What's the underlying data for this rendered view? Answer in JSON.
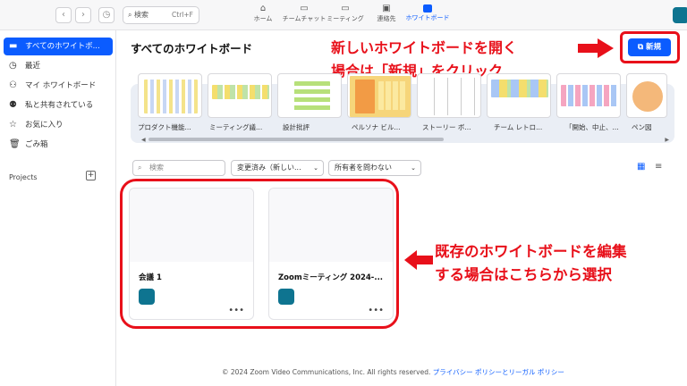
{
  "topbar": {
    "search_label": "検索",
    "search_shortcut": "Ctrl+F",
    "tabs": [
      {
        "label": "ホーム",
        "icon": "home-icon"
      },
      {
        "label": "チームチャット",
        "icon": "chat-icon"
      },
      {
        "label": "ミーティング",
        "icon": "video-icon"
      },
      {
        "label": "連絡先",
        "icon": "contacts-icon"
      },
      {
        "label": "ホワイトボード",
        "icon": "whiteboard-icon",
        "active": true
      }
    ]
  },
  "sidebar": {
    "items": [
      {
        "label": "すべてのホワイトボ...",
        "icon": "board-icon",
        "active": true
      },
      {
        "label": "最近",
        "icon": "clock-icon"
      },
      {
        "label": "マイ ホワイトボード",
        "icon": "person-icon"
      },
      {
        "label": "私と共有されている",
        "icon": "people-icon"
      },
      {
        "label": "お気に入り",
        "icon": "star-icon"
      },
      {
        "label": "ごみ箱",
        "icon": "trash-icon"
      }
    ],
    "projects_label": "Projects"
  },
  "main": {
    "title": "すべてのホワイトボード",
    "new_button": "新規",
    "templates": [
      "プロダクト機能...",
      "ミーティング議...",
      "設計批評",
      "ペルソナ ビル...",
      "ストーリー ボ...",
      "チーム レトロ...",
      "「開始、中止、...",
      "ペン図"
    ],
    "filters": {
      "search_placeholder": "検索",
      "sort": "変更済み（新しい...",
      "owner": "所有者を問わない"
    },
    "boards": [
      {
        "title": "会議 1"
      },
      {
        "title": "Zoomミーティング 2024-..."
      }
    ]
  },
  "annotations": {
    "new_line1": "新しいホワイトボードを開く",
    "new_line2": "場合は「新規」をクリック",
    "existing_line1": "既存のホワイトボードを編集",
    "existing_line2": "する場合はこちらから選択",
    "color": "#e8101a"
  },
  "footer": {
    "copyright": "© 2024 Zoom Video Communications, Inc. All rights reserved.",
    "link": "プライバシー ポリシーとリーガル ポリシー"
  },
  "colors": {
    "accent": "#0b5cff",
    "avatar": "#0e7490"
  }
}
